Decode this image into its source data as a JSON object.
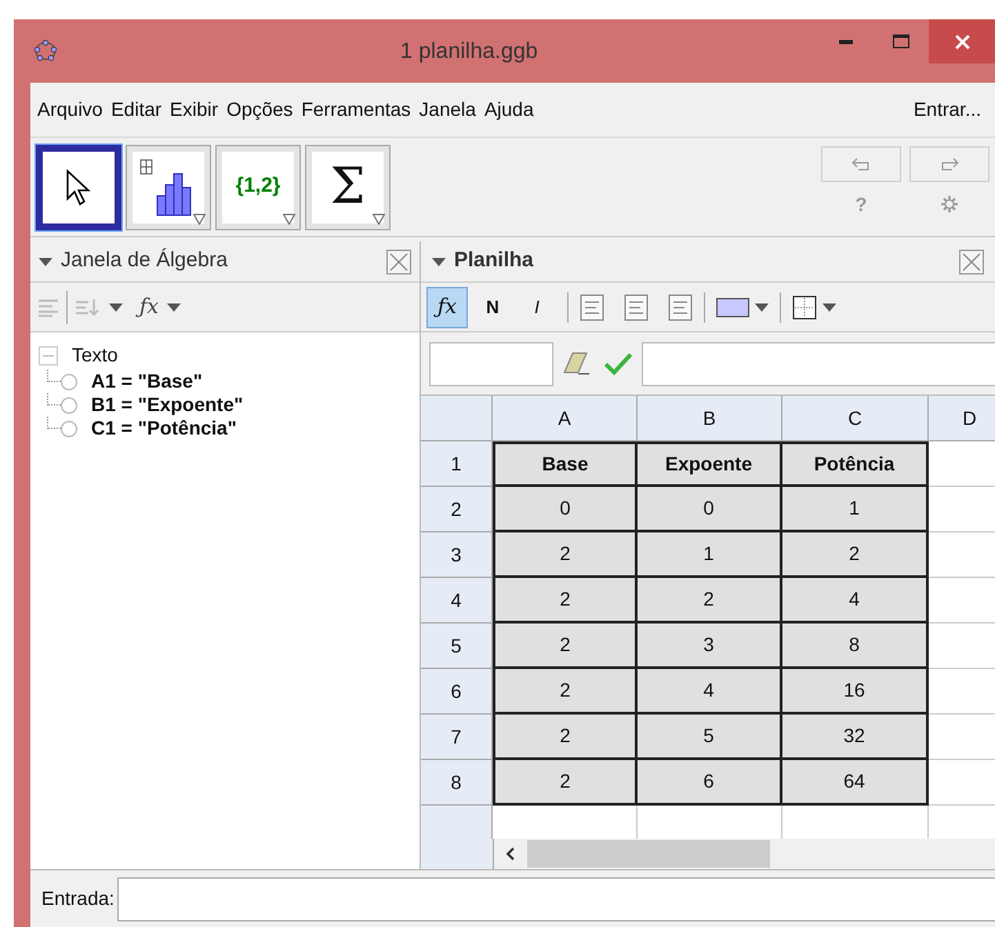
{
  "window": {
    "title": "1 planilha.ggb"
  },
  "menu": [
    "Arquivo",
    "Editar",
    "Exibir",
    "Opções",
    "Ferramentas",
    "Janela",
    "Ajuda"
  ],
  "login": "Entrar...",
  "tools": [
    {
      "kind": "move",
      "selected": true
    },
    {
      "kind": "chart",
      "selected": false
    },
    {
      "kind": "list",
      "label": "{1,2}",
      "selected": false
    },
    {
      "kind": "sum",
      "label": "Σ",
      "selected": false
    }
  ],
  "help": "?",
  "algebra": {
    "title": "Janela de Álgebra",
    "function_menu": "ƒx",
    "tree": [
      {
        "label": "Texto",
        "expanded": true,
        "children": [
          {
            "label": "A1 = \"Base\"",
            "visible": false
          },
          {
            "label": "B1 = \"Expoente\"",
            "visible": false
          },
          {
            "label": "C1 = \"Potência\"",
            "visible": false
          }
        ]
      }
    ]
  },
  "spreadsheet": {
    "title": "Planilha",
    "format": [
      {
        "kind": "fx",
        "label": "ƒx",
        "selected": true
      },
      {
        "kind": "bold",
        "label": "N",
        "selected": false
      },
      {
        "kind": "italic",
        "label": "I",
        "selected": false
      }
    ],
    "columns": [
      "A",
      "B",
      "C",
      "D"
    ],
    "rows": [
      {
        "label": "1",
        "bold": true,
        "cells": [
          "Base",
          "Expoente",
          "Potência"
        ]
      },
      {
        "label": "2",
        "bold": false,
        "cells": [
          "0",
          "0",
          "1"
        ]
      },
      {
        "label": "3",
        "bold": false,
        "cells": [
          "2",
          "1",
          "2"
        ]
      },
      {
        "label": "4",
        "bold": false,
        "cells": [
          "2",
          "2",
          "4"
        ]
      },
      {
        "label": "5",
        "bold": false,
        "cells": [
          "2",
          "3",
          "8"
        ]
      },
      {
        "label": "6",
        "bold": false,
        "cells": [
          "2",
          "4",
          "16"
        ]
      },
      {
        "label": "7",
        "bold": false,
        "cells": [
          "2",
          "5",
          "32"
        ]
      },
      {
        "label": "8",
        "bold": false,
        "cells": [
          "2",
          "6",
          "64"
        ]
      }
    ]
  },
  "input_bar": {
    "label": "Entrada:"
  }
}
